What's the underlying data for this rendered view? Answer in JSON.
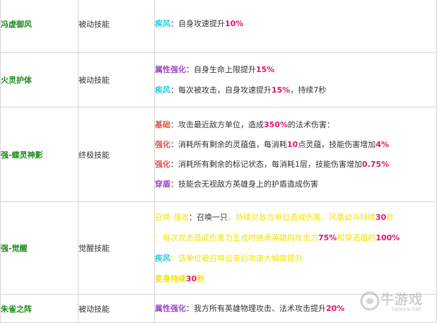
{
  "colors": {
    "name_green": "#1d8a1d",
    "cyan": "#22c8d8",
    "purple": "#9b48c8",
    "red_label": "#e25050",
    "yellow": "#f0e400",
    "number_pink": "#e0156a"
  },
  "rows": {
    "r1": {
      "name": "冯虚御风",
      "type": "被动技能",
      "l1": {
        "label": "疾风",
        "text": "：自身攻速提升",
        "n1": "10%"
      }
    },
    "r2": {
      "name": "火灵护体",
      "type": "被动技能",
      "l1": {
        "label": "属性强化",
        "text": "：自身生命上限提升",
        "n1": "15%"
      },
      "l2": {
        "label": "疾风",
        "text": "：每次被攻击，自身攻速提升",
        "n1": "15%",
        "tail": "，持续7秒"
      }
    },
    "r3": {
      "name": "强-蝶灵神影",
      "type": "终极技能",
      "l1": {
        "label": "基础",
        "text": "：攻击最近敌方单位，造成",
        "n1": "350%",
        "tail": "的法术伤害："
      },
      "l2": {
        "label": "强化",
        "text": "：消耗所有剩余的灵蕴值，每消耗",
        "n1": "10",
        "mid": "点灵蕴，技能伤害增加",
        "n2": "4%"
      },
      "l3": {
        "label": "强化",
        "text": "：消耗所有剩余的标记状态，每消耗1层，技能伤害增加",
        "n1": "0.75%"
      },
      "l4": {
        "label": "穿盾",
        "text": "：技能会无视敌方英雄身上的护盾造成伤害"
      }
    },
    "r4": {
      "name": "强-觉醒",
      "type": "觉醒技能",
      "l1": {
        "label": "召唤-强攻",
        "text": "：召唤一只",
        "yel": "，持续对敌方单位造成伤害，凤凰幼鸟持续",
        "n1": "30",
        "tail": "秒"
      },
      "l2": {
        "text": "：每次攻击造成伤害为生成时继承英雄的攻击力",
        "n1": "75%",
        "mid": "和穿透值的",
        "n2": "100%"
      },
      "l3": {
        "label": "疾风",
        "text": "：该单位被召唤出来后攻速大幅度提升"
      },
      "l4": {
        "text": "变身持续",
        "n1": "30",
        "tail": "秒"
      }
    },
    "r5": {
      "name": "朱雀之阵",
      "type": "被动技能",
      "l1": {
        "label": "属性强化",
        "text": "：我方所有英雄物理攻击、法术攻击提升",
        "n1": "20%"
      }
    }
  },
  "watermark": {
    "brand": "牛游戏",
    "site": "newyx.net"
  }
}
